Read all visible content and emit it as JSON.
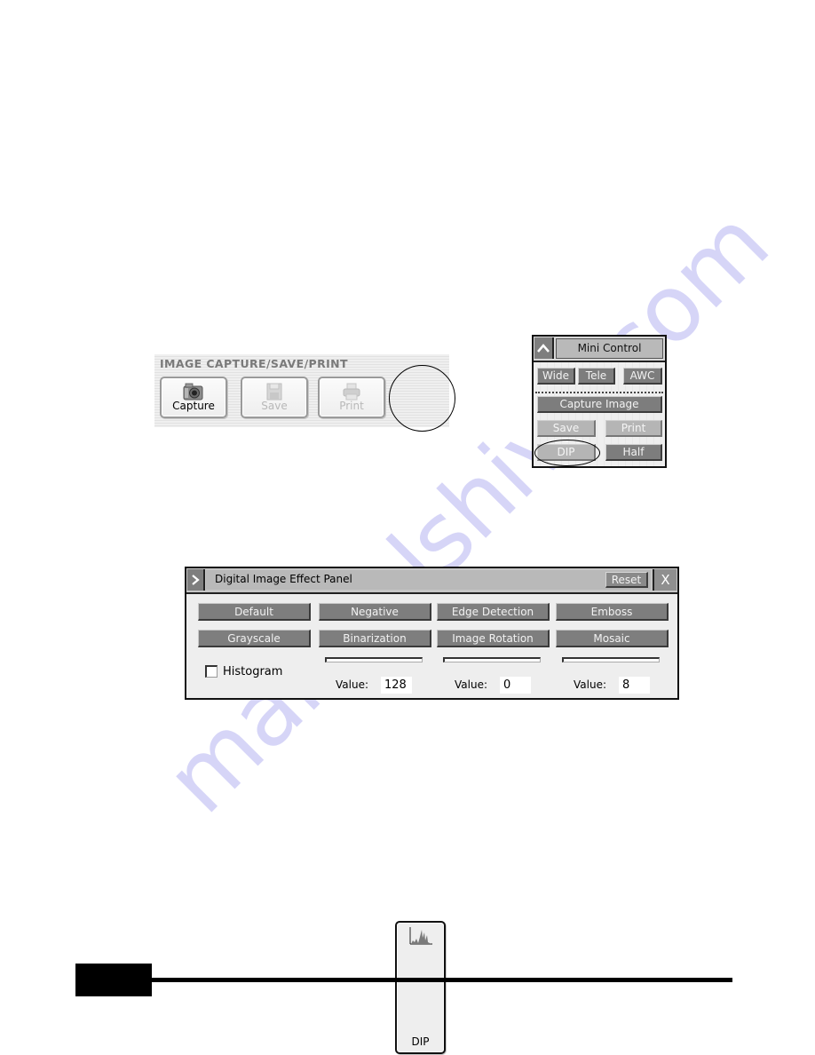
{
  "capture_toolbar": {
    "title": "IMAGE CAPTURE/SAVE/PRINT",
    "buttons": [
      {
        "label": "Capture",
        "icon": "camera-icon",
        "enabled": true
      },
      {
        "label": "Save",
        "icon": "floppy-disk-icon",
        "enabled": false
      },
      {
        "label": "Print",
        "icon": "printer-icon",
        "enabled": false
      },
      {
        "label": "DIP",
        "icon": "histogram-icon",
        "enabled": true,
        "highlighted": true
      }
    ]
  },
  "mini_control": {
    "title": "Mini Control",
    "collapse_icon": "chevron-up-icon",
    "buttons": {
      "wide": "Wide",
      "tele": "Tele",
      "awc": "AWC",
      "capture_image": "Capture Image",
      "save": "Save",
      "print": "Print",
      "dip": "DIP",
      "half": "Half"
    },
    "highlighted": "DIP"
  },
  "effect_panel": {
    "title": "Digital Image Effect Panel",
    "expand_icon": "chevron-right-icon",
    "reset_label": "Reset",
    "close_label": "X",
    "effects_row1": [
      "Default",
      "Negative",
      "Edge Detection",
      "Emboss"
    ],
    "effects_row2": [
      "Grayscale",
      "Binarization",
      "Image Rotation",
      "Mosaic"
    ],
    "histogram_label": "Histogram",
    "histogram_checked": false,
    "value_label": "Value:",
    "sliders": [
      {
        "for": "Binarization",
        "value": "128"
      },
      {
        "for": "Image Rotation",
        "value": "0"
      },
      {
        "for": "Mosaic",
        "value": "8"
      }
    ]
  },
  "watermark": {
    "text": "manualshive.com",
    "color": "#c9c8f5"
  }
}
